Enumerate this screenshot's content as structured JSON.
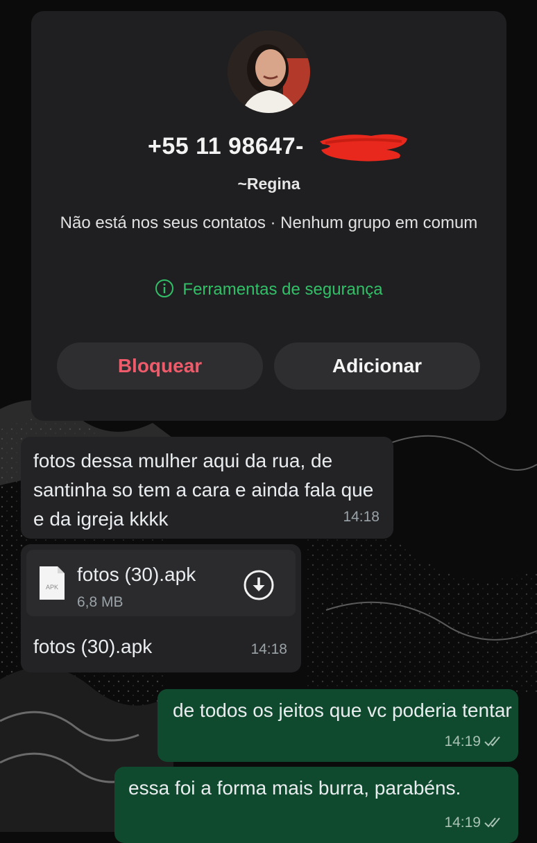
{
  "contact": {
    "phone": "+55 11 98647-",
    "username": "~Regina",
    "info": "Não está nos seus contatos · Nenhum grupo em comum",
    "safety_tools": "Ferramentas de segurança",
    "block_label": "Bloquear",
    "add_label": "Adicionar"
  },
  "messages": [
    {
      "direction": "incoming",
      "text": "fotos dessa mulher aqui da rua, de santinha so tem a cara e ainda fala que e da igreja kkkk",
      "time": "14:18"
    },
    {
      "direction": "incoming",
      "file": {
        "icon_label": "APK",
        "name": "fotos (30).apk",
        "size": "6,8 MB"
      },
      "text": "fotos (30).apk",
      "time": "14:18"
    },
    {
      "direction": "outgoing",
      "text": "de todos os jeitos que vc poderia tentar",
      "time": "14:19",
      "status": "read"
    },
    {
      "direction": "outgoing",
      "text": "essa foi a forma mais burra, parabéns.",
      "time": "14:19",
      "status": "read"
    }
  ],
  "colors": {
    "background": "#0b0b0b",
    "card": "#1f1f21",
    "incoming_bubble": "#232325",
    "outgoing_bubble": "#0f4a2e",
    "safety_green": "#31c067",
    "block_red": "#ee5c6b",
    "redaction": "#e8281c"
  },
  "icons": [
    "info-icon",
    "apk-file-icon",
    "download-icon",
    "double-check-icon"
  ]
}
